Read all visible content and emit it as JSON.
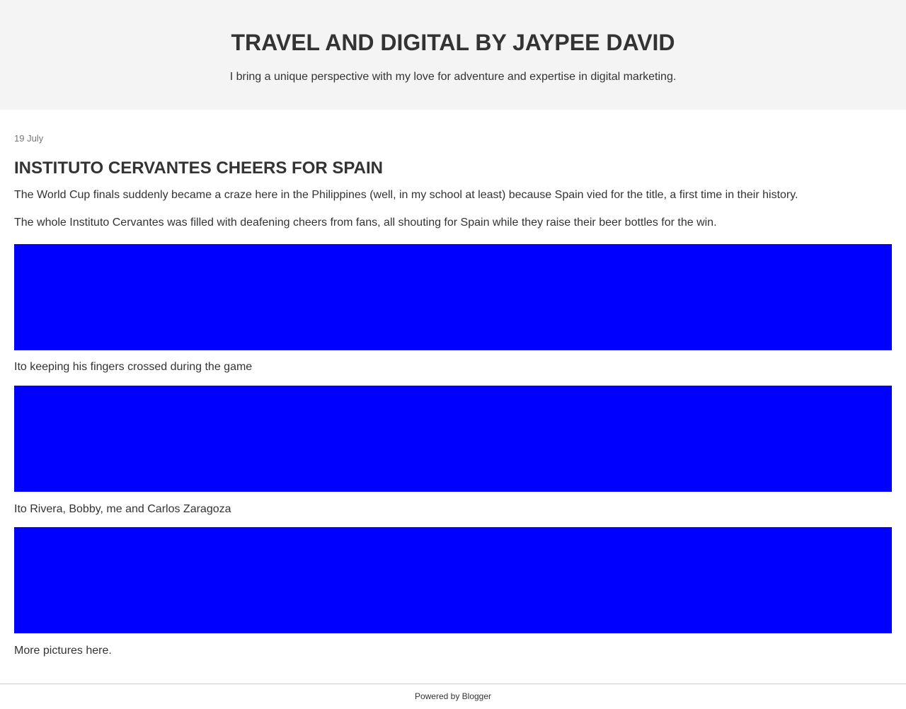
{
  "header": {
    "title": "TRAVEL AND DIGITAL BY JAYPEE DAVID",
    "description": "I bring a unique perspective with my love for adventure and expertise in digital marketing."
  },
  "post": {
    "date": "19 July",
    "title": "INSTITUTO CERVANTES CHEERS FOR SPAIN",
    "paragraphs": [
      "The World Cup finals suddenly became a craze here in the Philippines (well, in my school at least) because Spain vied for the title, a first time in their history.",
      "The whole Instituto Cervantes was filled with deafening cheers from fans, all shouting for Spain while they raise their beer bottles for the win."
    ],
    "photos": [
      {
        "caption": "Ito keeping his fingers crossed during the game",
        "color": "#0000ff"
      },
      {
        "caption": "Ito Rivera, Bobby, me and Carlos Zaragoza",
        "color": "#0000ff"
      },
      {
        "caption": "More pictures here.",
        "color": "#0000ff"
      }
    ]
  },
  "footer": {
    "text": "Powered by Blogger"
  }
}
